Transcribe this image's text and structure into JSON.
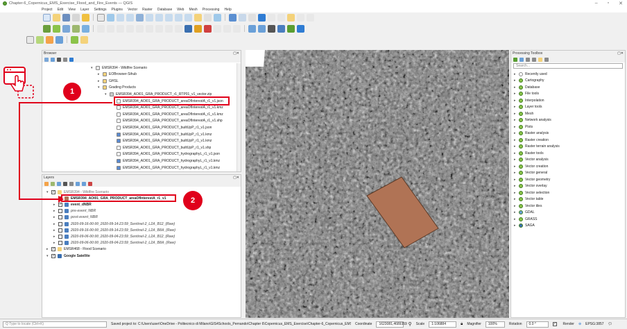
{
  "window": {
    "title": "Chapter-6_Copernicus_EMS_Exercise_Flood_and_Fire_Events — QGIS"
  },
  "menu": [
    "Project",
    "Edit",
    "View",
    "Layer",
    "Settings",
    "Plugins",
    "Vector",
    "Raster",
    "Database",
    "Web",
    "Mesh",
    "Processing",
    "Help"
  ],
  "browser": {
    "title": "Browser",
    "items": [
      {
        "label": "EMSR394 - Wildfire Scenario"
      },
      {
        "label": "EOBrowser-Sihub"
      },
      {
        "label": "GHSL"
      },
      {
        "label": "Grading Products"
      },
      {
        "label": "EMSR394_AOI01_GRA_PRODUCT_r1_RTP01_v1_vector.zip"
      },
      {
        "label": "EMSR394_AOI01_GRA_PRODUCT_areaOfInterestA_r1_v1.json"
      },
      {
        "label": "EMSR394_AOI01_GRA_PRODUCT_areaOfInterestA_r1_v1.kmz"
      },
      {
        "label": "EMSR394_AOI01_GRA_PRODUCT_areaOfInterestA_r1_v1.kmz"
      },
      {
        "label": "EMSR394_AOI01_GRA_PRODUCT_areaOfInterestA_r1_v1.shp"
      },
      {
        "label": "EMSR394_AOI01_GRA_PRODUCT_builtUpP_r1_v1.json"
      },
      {
        "label": "EMSR394_AOI01_GRA_PRODUCT_builtUpP_r1_v1.kmz"
      },
      {
        "label": "EMSR394_AOI01_GRA_PRODUCT_builtUpP_r1_v1.kmz"
      },
      {
        "label": "EMSR394_AOI01_GRA_PRODUCT_builtUpP_r1_v1.shp"
      },
      {
        "label": "EMSR394_AOI01_GRA_PRODUCT_hydrographyL_r1_v1.json"
      },
      {
        "label": "EMSR394_AOI01_GRA_PRODUCT_hydrographyL_r1_v1.kmz"
      },
      {
        "label": "EMSR394_AOI01_GRA_PRODUCT_hydrographyL_r1_v1.kmz"
      }
    ]
  },
  "layers": {
    "title": "Layers",
    "items": [
      {
        "label": "EMSR394 - Wildfire Scenario"
      },
      {
        "label": "EMSR394_AOI01_GRA_PRODUCT_areaOfInterestA_r1_v1"
      },
      {
        "label": "event_dNBR"
      },
      {
        "label": "pre-event_NBR"
      },
      {
        "label": "post-event_NBR"
      },
      {
        "label": "2020-09-16-00:00_2020-09-14-23:59_Sentinel-2_L2A_B12_(Raw)"
      },
      {
        "label": "2020-09-16-00:00_2020-09-14-23:59_Sentinel-2_L2A_B8A_(Raw)"
      },
      {
        "label": "2020-09-06-00:00_2020-09-04-23:59_Sentinel-2_L2A_B12_(Raw)"
      },
      {
        "label": "2020-09-06-00:00_2020-09-04-23:59_Sentinel-2_L2A_B8A_(Raw)"
      },
      {
        "label": "EMSR468 - Flood Scenario"
      },
      {
        "label": "Google Satellite"
      }
    ]
  },
  "toolbox": {
    "title": "Processing Toolbox",
    "search_placeholder": "Search...",
    "items": [
      "Recently used",
      "Cartography",
      "Database",
      "File tools",
      "Interpolation",
      "Layer tools",
      "Mesh",
      "Network analysis",
      "Plots",
      "Raster analysis",
      "Raster creation",
      "Raster terrain analysis",
      "Raster tools",
      "Vector analysis",
      "Vector creation",
      "Vector general",
      "Vector geometry",
      "Vector overlay",
      "Vector selection",
      "Vector table",
      "Vector tiles",
      "GDAL",
      "GRASS",
      "SAGA"
    ]
  },
  "status": {
    "locate_placeholder": "Q  Type to locate (Ctrl+K)",
    "message": "Saved project to: C:\\Users\\user\\OneDrive - Politecnico di Milano\\GIS4Schools_Pernando\\Chapter 6\\Copernicus_EMS_Exercise\\Chapter-6_Copernicus_EMS_Exercise_Flood_",
    "coordinate_label": "Coordinate",
    "coordinate_value": "1623081,4689359",
    "scale_label": "Scale",
    "scale_value": "1:106884",
    "magnifier_label": "Magnifier",
    "magnifier_value": "100%",
    "rotation_label": "Rotation",
    "rotation_value": "0.0 °",
    "render_label": "Render",
    "crs": "EPSG:3857"
  },
  "annotations": {
    "badge1": "1",
    "badge2": "2"
  },
  "colors": {
    "accent_red": "#e0001b",
    "polygon_fill": "#b07355",
    "qgis_green": "#5a9e32"
  }
}
